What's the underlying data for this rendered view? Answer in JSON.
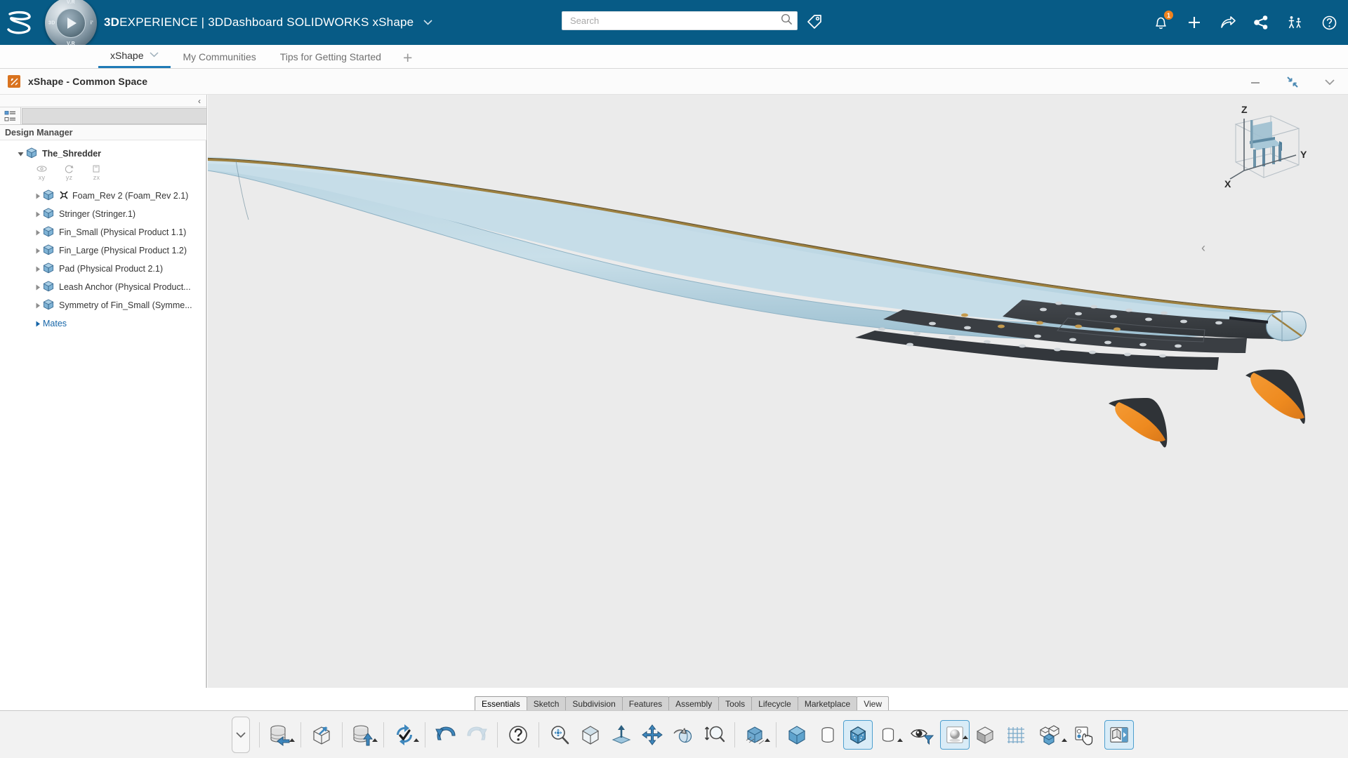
{
  "topbar": {
    "brand_bold": "3D",
    "brand_rest": "EXPERIENCE",
    "brand_sep": "|",
    "brand_app": "3DDashboard",
    "brand_sub": "SOLIDWORKS xShape",
    "brand_caret": "⌵",
    "compass": {
      "n": "V.R",
      "s": "V.R",
      "w": "3D",
      "e": "i’",
      "top": "V.R"
    },
    "search": {
      "placeholder": "Search",
      "value": "",
      "icon": "search-icon"
    },
    "tag_icon": "tag-icon",
    "actions": [
      {
        "name": "notifications-icon",
        "badge": "1"
      },
      {
        "name": "add-icon",
        "badge": ""
      },
      {
        "name": "share-arrow-icon",
        "badge": ""
      },
      {
        "name": "share-network-icon",
        "badge": ""
      },
      {
        "name": "collaboration-icon",
        "badge": ""
      },
      {
        "name": "help-icon",
        "badge": ""
      }
    ]
  },
  "dashboard_tabs": {
    "items": [
      {
        "label": "xShape",
        "active": true,
        "has_caret": true
      },
      {
        "label": "My Communities",
        "active": false,
        "has_caret": false
      },
      {
        "label": "Tips for Getting Started",
        "active": false,
        "has_caret": false
      }
    ],
    "add_label": "+"
  },
  "app_window": {
    "title": "xShape - Common Space",
    "icon": "xshape-icon",
    "controls": [
      {
        "name": "minimize-button",
        "glyph": "—"
      },
      {
        "name": "restore-button",
        "glyph": "restore"
      },
      {
        "name": "more-button",
        "glyph": "⌵"
      }
    ]
  },
  "design_manager": {
    "panel_title": "Design Manager",
    "collapse_glyph": "‹",
    "tree_tab_icon": "tree-view-icon",
    "root": {
      "label": "The_Shredder",
      "expanded": true
    },
    "planes": [
      {
        "label": "xy",
        "icon": "plane-xy-icon"
      },
      {
        "label": "yz",
        "icon": "plane-yz-icon"
      },
      {
        "label": "zx",
        "icon": "plane-zx-icon"
      }
    ],
    "items": [
      {
        "label": "Foam_Rev 2 (Foam_Rev 2.1)",
        "has_subdiv_badge": true
      },
      {
        "label": "Stringer (Stringer.1)",
        "has_subdiv_badge": false
      },
      {
        "label": "Fin_Small (Physical Product 1.1)",
        "has_subdiv_badge": false
      },
      {
        "label": "Fin_Large (Physical Product 1.2)",
        "has_subdiv_badge": false
      },
      {
        "label": "Pad (Physical Product 2.1)",
        "has_subdiv_badge": false
      },
      {
        "label": "Leash Anchor (Physical Product...",
        "has_subdiv_badge": false
      },
      {
        "label": "Symmetry of Fin_Small (Symme...",
        "has_subdiv_badge": false
      }
    ],
    "mates": {
      "label": "Mates"
    }
  },
  "viewport": {
    "background": "#ebebeb",
    "collapse_glyph": "‹",
    "view_cube": {
      "axis_z": "Z",
      "axis_y": "Y",
      "axis_x": "X",
      "name": "view-compass"
    },
    "model": {
      "name": "surfboard-model",
      "board_color": "#bed8e4",
      "stringer_color": "#9d803f",
      "pad_color": "#3b3f43",
      "fin_color": "#ef8a22"
    }
  },
  "command_tabs": {
    "items": [
      {
        "label": "Essentials",
        "active": true
      },
      {
        "label": "Sketch",
        "active": false
      },
      {
        "label": "Subdivision",
        "active": false
      },
      {
        "label": "Features",
        "active": false
      },
      {
        "label": "Assembly",
        "active": false
      },
      {
        "label": "Tools",
        "active": false
      },
      {
        "label": "Lifecycle",
        "active": false
      },
      {
        "label": "Marketplace",
        "active": false
      },
      {
        "label": "View",
        "active": false,
        "last": true
      }
    ]
  },
  "toolbar": {
    "expand_glyph": "⌵",
    "groups": [
      {
        "buttons": [
          {
            "name": "open-from-database-button",
            "caret": true,
            "selected": false,
            "disabled": false
          },
          {
            "name": "open-local-button",
            "caret": false,
            "selected": false,
            "disabled": false
          },
          {
            "name": "save-to-database-button",
            "caret": true,
            "selected": false,
            "disabled": false
          },
          {
            "name": "update-refresh-button",
            "caret": true,
            "selected": false,
            "disabled": false
          }
        ]
      },
      {
        "buttons": [
          {
            "name": "undo-button",
            "caret": false,
            "selected": false,
            "disabled": false
          },
          {
            "name": "redo-button",
            "caret": false,
            "selected": false,
            "disabled": true
          }
        ]
      },
      {
        "buttons": [
          {
            "name": "help-button",
            "caret": false,
            "selected": false,
            "disabled": false
          }
        ]
      },
      {
        "buttons": [
          {
            "name": "zoom-to-fit-button",
            "caret": false,
            "selected": false,
            "disabled": false
          },
          {
            "name": "isometric-view-button",
            "caret": false,
            "selected": false,
            "disabled": false
          },
          {
            "name": "normal-to-button",
            "caret": false,
            "selected": false,
            "disabled": false
          },
          {
            "name": "pan-button",
            "caret": false,
            "selected": false,
            "disabled": false
          },
          {
            "name": "rotate-button",
            "caret": false,
            "selected": false,
            "disabled": false
          },
          {
            "name": "zoom-window-button",
            "caret": false,
            "selected": false,
            "disabled": false
          }
        ]
      },
      {
        "buttons": [
          {
            "name": "hidden-edges-button",
            "caret": true,
            "selected": false,
            "disabled": false
          }
        ]
      },
      {
        "buttons": [
          {
            "name": "shaded-button",
            "caret": false,
            "selected": false,
            "disabled": false
          },
          {
            "name": "wireframe-button",
            "caret": false,
            "selected": false,
            "disabled": false
          },
          {
            "name": "shaded-with-edges-button",
            "caret": false,
            "selected": true,
            "disabled": false
          },
          {
            "name": "display-style-button",
            "caret": true,
            "selected": false,
            "disabled": false
          },
          {
            "name": "visibility-filter-button",
            "caret": false,
            "selected": false,
            "disabled": false
          },
          {
            "name": "appearance-button",
            "caret": true,
            "selected": true,
            "disabled": false
          },
          {
            "name": "material-button",
            "caret": false,
            "selected": false,
            "disabled": false
          },
          {
            "name": "grid-button",
            "caret": false,
            "selected": false,
            "disabled": false
          },
          {
            "name": "exploded-view-button",
            "caret": true,
            "selected": false,
            "disabled": false
          },
          {
            "name": "selection-filter-button",
            "caret": false,
            "selected": false,
            "disabled": false
          },
          {
            "name": "show-panel-button",
            "caret": false,
            "selected": true,
            "disabled": false
          }
        ]
      }
    ]
  }
}
